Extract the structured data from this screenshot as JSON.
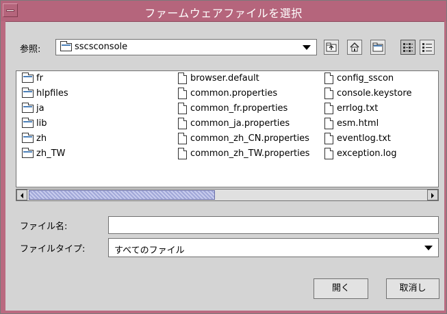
{
  "window": {
    "title": "ファームウェアファイルを選択"
  },
  "toolbar": {
    "look_in_label": "参照:",
    "look_in_value": "sscsconsole",
    "buttons": [
      {
        "name": "up-one-level",
        "icon": "folder-up-icon"
      },
      {
        "name": "home",
        "icon": "home-icon"
      },
      {
        "name": "new-folder",
        "icon": "new-folder-icon"
      },
      {
        "name": "list-view",
        "icon": "list-view-icon",
        "selected": true
      },
      {
        "name": "details-view",
        "icon": "details-view-icon"
      }
    ]
  },
  "files": {
    "col1": [
      {
        "name": "fr",
        "type": "folder"
      },
      {
        "name": "hlpfiles",
        "type": "folder"
      },
      {
        "name": "ja",
        "type": "folder"
      },
      {
        "name": "lib",
        "type": "folder"
      },
      {
        "name": "zh",
        "type": "folder"
      },
      {
        "name": "zh_TW",
        "type": "folder"
      }
    ],
    "col2": [
      {
        "name": "browser.default",
        "type": "file"
      },
      {
        "name": "common.properties",
        "type": "file"
      },
      {
        "name": "common_fr.properties",
        "type": "file"
      },
      {
        "name": "common_ja.properties",
        "type": "file"
      },
      {
        "name": "common_zh_CN.properties",
        "type": "file"
      },
      {
        "name": "common_zh_TW.properties",
        "type": "file"
      }
    ],
    "col3": [
      {
        "name": "config_sscon",
        "type": "file"
      },
      {
        "name": "console.keystore",
        "type": "file"
      },
      {
        "name": "errlog.txt",
        "type": "file"
      },
      {
        "name": "esm.html",
        "type": "file"
      },
      {
        "name": "eventlog.txt",
        "type": "file"
      },
      {
        "name": "exception.log",
        "type": "file"
      }
    ]
  },
  "filename": {
    "label": "ファイル名:",
    "value": ""
  },
  "filetype": {
    "label": "ファイルタイプ:",
    "value": "すべてのファイル"
  },
  "buttons": {
    "open": "開く",
    "cancel": "取消し"
  },
  "colors": {
    "titlebar": "#b5657c",
    "window_bg": "#d4d4d4",
    "scroll_thumb": "#a0a7d8"
  }
}
